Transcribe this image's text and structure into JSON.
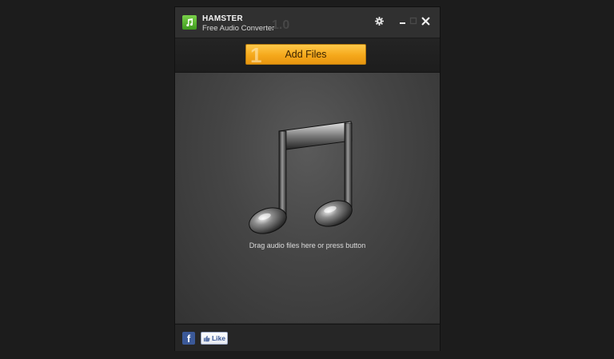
{
  "titlebar": {
    "app_name": "HAMSTER",
    "app_subtitle": "Free Audio Converter",
    "version": "1.0"
  },
  "toolbar": {
    "step_number": "1",
    "add_files_label": "Add Files"
  },
  "dropzone": {
    "hint": "Drag audio files here or press button"
  },
  "footer": {
    "like_label": "Like",
    "facebook_glyph": "f"
  },
  "icons": {
    "logo": "music-note-icon",
    "settings": "gear-icon",
    "minimize": "minimize-icon",
    "maximize": "maximize-icon",
    "close": "close-icon",
    "hero": "music-note-icon",
    "facebook": "facebook-icon",
    "like": "thumbs-up-icon"
  },
  "colors": {
    "accent": "#f5a81b",
    "window": "#2b2b2b",
    "background": "#1c1c1c",
    "facebook": "#3b5998"
  }
}
